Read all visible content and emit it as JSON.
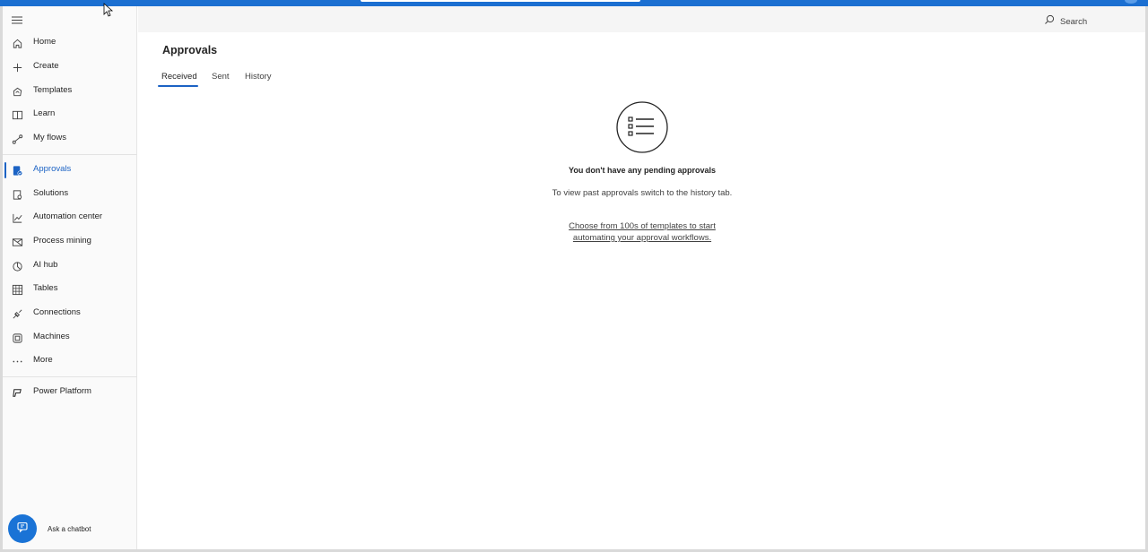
{
  "sidebar": {
    "items": [
      {
        "label": "Home",
        "icon": "home-icon"
      },
      {
        "label": "Create",
        "icon": "plus-icon"
      },
      {
        "label": "Templates",
        "icon": "templates-icon"
      },
      {
        "label": "Learn",
        "icon": "book-icon"
      },
      {
        "label": "My flows",
        "icon": "flow-icon"
      },
      {
        "label": "Approvals",
        "icon": "approvals-icon",
        "active": true
      },
      {
        "label": "Solutions",
        "icon": "solutions-icon"
      },
      {
        "label": "Automation center",
        "icon": "chart-icon"
      },
      {
        "label": "Process mining",
        "icon": "process-mining-icon"
      },
      {
        "label": "AI hub",
        "icon": "ai-hub-icon"
      },
      {
        "label": "Tables",
        "icon": "table-icon"
      },
      {
        "label": "Connections",
        "icon": "connections-icon"
      },
      {
        "label": "Machines",
        "icon": "machine-icon"
      },
      {
        "label": "More",
        "icon": "more-icon"
      },
      {
        "label": "Power Platform",
        "icon": "power-platform-icon"
      }
    ],
    "chatbot_label": "Ask a chatbot"
  },
  "header": {
    "search_label": "Search"
  },
  "main": {
    "title": "Approvals",
    "tabs": [
      {
        "label": "Received",
        "active": true
      },
      {
        "label": "Sent"
      },
      {
        "label": "History"
      }
    ],
    "empty_state": {
      "title": "You don't have any pending approvals",
      "subtitle": "To view past approvals switch to the history tab.",
      "link": "Choose from 100s of templates to start automating your approval workflows."
    }
  },
  "colors": {
    "accent": "#1c63c4",
    "topbar": "#1b6fd1",
    "chatbot": "#1a73d6"
  }
}
